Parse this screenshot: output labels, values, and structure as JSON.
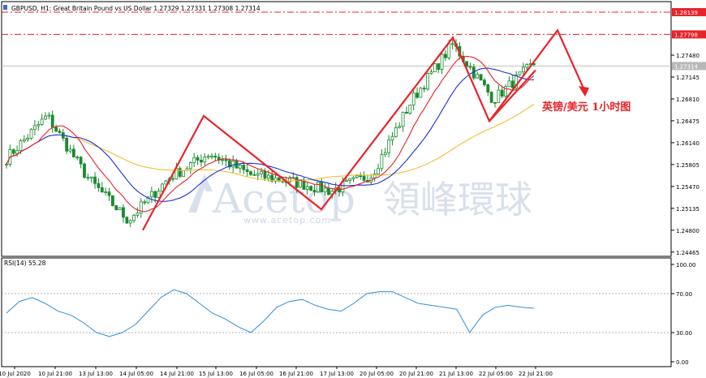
{
  "header": {
    "symbol": "GBPUSD, H1:",
    "description": "Great Britain Pound vs US Dollar",
    "ohlc": "1.27329 1.27331 1.27308 1.27314"
  },
  "annotation": "英镑/美元 1小时图",
  "watermark": {
    "brand": "Acetop",
    "cn": "領峰環球",
    "url": "www.acetop.com"
  },
  "colors": {
    "candle": "#1b8a2e",
    "ma_fast": "#e8232a",
    "ma_mid": "#1e2fd6",
    "ma_slow": "#f0c030",
    "rsi": "#2f8fd8",
    "arrow": "#e8232a",
    "tag": "#e8232a",
    "last_tag": "#b8b8b8"
  },
  "price_axis": {
    "ticks": [
      "1.27480",
      "1.27145",
      "1.26810",
      "1.26475",
      "1.26140",
      "1.25805",
      "1.25470",
      "1.25135",
      "1.24800",
      "1.24465"
    ],
    "level_tags": [
      "1.28139",
      "1.27798"
    ],
    "last_price": "1.27314"
  },
  "rsi_panel": {
    "label": "RSI(14) 55.28",
    "ticks": [
      "100.00",
      "70.00",
      "30.00",
      "0.00"
    ]
  },
  "time_axis": [
    "10 Jul 2020",
    "10 Jul 21:00",
    "13 Jul 13:00",
    "14 Jul 05:00",
    "14 Jul 21:00",
    "15 Jul 13:00",
    "16 Jul 05:00",
    "16 Jul 21:00",
    "17 Jul 13:00",
    "20 Jul 05:00",
    "20 Jul 21:00",
    "21 Jul 13:00",
    "22 Jul 05:00",
    "22 Jul 21:00"
  ],
  "chart_data": [
    {
      "type": "candlestick",
      "symbol": "GBPUSD",
      "timeframe": "H1",
      "ylim": [
        1.244,
        1.283
      ],
      "horizontal_levels": [
        1.28139,
        1.27798
      ],
      "last_price": 1.27314,
      "close_path": [
        {
          "t": "10 Jul 2020",
          "close": 1.259
        },
        {
          "t": "10 Jul 21:00",
          "close": 1.2655
        },
        {
          "t": "13 Jul 13:00",
          "close": 1.256
        },
        {
          "t": "14 Jul 05:00",
          "close": 1.2495
        },
        {
          "t": "14 Jul 21:00",
          "close": 1.256
        },
        {
          "t": "15 Jul 13:00",
          "close": 1.2598
        },
        {
          "t": "16 Jul 05:00",
          "close": 1.2565
        },
        {
          "t": "16 Jul 21:00",
          "close": 1.2555
        },
        {
          "t": "17 Jul 13:00",
          "close": 1.254
        },
        {
          "t": "20 Jul 05:00",
          "close": 1.2565
        },
        {
          "t": "20 Jul 21:00",
          "close": 1.268
        },
        {
          "t": "21 Jul 13:00",
          "close": 1.2765
        },
        {
          "t": "22 Jul 05:00",
          "close": 1.268
        },
        {
          "t": "22 Jul 21:00",
          "close": 1.2735
        }
      ],
      "drawn_arrow_path": [
        1.248,
        1.2655,
        1.2512,
        1.2775,
        1.2647,
        1.2786,
        1.2692
      ]
    },
    {
      "type": "line",
      "name": "RSI(14)",
      "current": 55.28,
      "ylim": [
        0,
        100
      ],
      "levels": [
        70,
        30
      ],
      "values": [
        50,
        62,
        66,
        60,
        52,
        48,
        40,
        30,
        26,
        30,
        38,
        52,
        66,
        74,
        70,
        60,
        50,
        44,
        36,
        30,
        42,
        56,
        62,
        64,
        58,
        54,
        52,
        60,
        70,
        72,
        72,
        66,
        60,
        58,
        56,
        54,
        30,
        48,
        56,
        58,
        56,
        55
      ]
    }
  ]
}
